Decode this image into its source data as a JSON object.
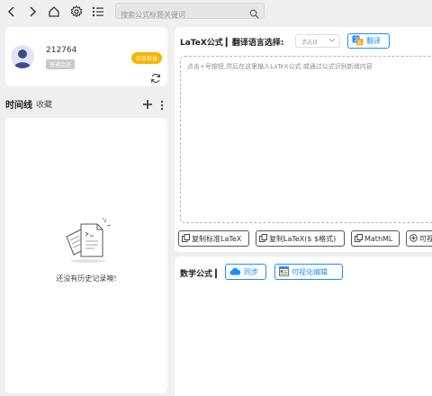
{
  "toolbar": {
    "icons": [
      "back-icon",
      "forward-icon",
      "home-icon",
      "settings-icon",
      "list-icon"
    ],
    "search_placeholder": "搜索公式标题关键词"
  },
  "user": {
    "id": "212764",
    "level": "普通会员",
    "vip_button": "会员权益"
  },
  "timeline": {
    "title": "时间线",
    "favorites": "收藏",
    "empty_text": "还没有历史记录噢!"
  },
  "latex": {
    "label": "LaTeX公式 ▎翻译语言选择:",
    "language_select": "请选择",
    "translate_button": "翻译",
    "editor_placeholder": "点击+号按钮,然后在这里输入LaTeX公式 或通过公式识别新增内容",
    "copy_buttons": [
      "复制标准LaTeX",
      "复制LaTeX($ $格式)",
      "MathML",
      "可视"
    ]
  },
  "math": {
    "label": "数学公式 ▎",
    "sync_button": "同步",
    "visual_edit_button": "可视化编辑"
  },
  "colors": {
    "accent": "#1890ff",
    "vip": "#f7b500",
    "background": "#efefef"
  }
}
